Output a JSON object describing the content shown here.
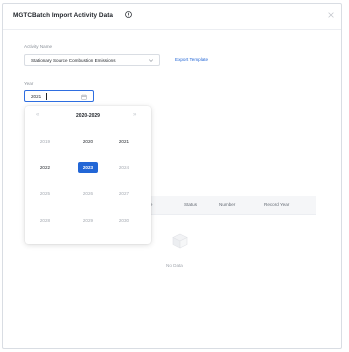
{
  "dialog": {
    "title": "MGTCBatch Import Activity Data",
    "activity_name_label": "Activity Name",
    "activity_name_value": "Stationary Source Combustion Emissions",
    "export_template": "Export Template",
    "year_label": "Year",
    "year_value": "2021"
  },
  "year_picker": {
    "decade": "2020-2029",
    "prev": "«",
    "next": "»",
    "rows": [
      [
        {
          "y": "2019",
          "state": "out"
        },
        {
          "y": "2020",
          "state": "in"
        },
        {
          "y": "2021",
          "state": "in"
        }
      ],
      [
        {
          "y": "2022",
          "state": "in"
        },
        {
          "y": "2023",
          "state": "selected"
        },
        {
          "y": "2024",
          "state": "out"
        }
      ],
      [
        {
          "y": "2025",
          "state": "out"
        },
        {
          "y": "2026",
          "state": "out"
        },
        {
          "y": "2027",
          "state": "out"
        }
      ],
      [
        {
          "y": "2028",
          "state": "out"
        },
        {
          "y": "2029",
          "state": "out"
        },
        {
          "y": "2030",
          "state": "out"
        }
      ]
    ]
  },
  "table": {
    "columns": [
      "me",
      "Status",
      "Number",
      "Record Year"
    ],
    "empty_text": "No Data"
  },
  "colors": {
    "accent": "#2266d6",
    "border": "#d9dde3"
  }
}
